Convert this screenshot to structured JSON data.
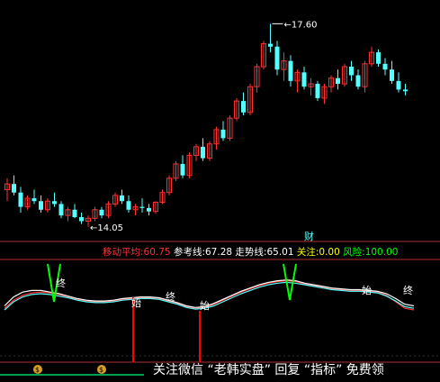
{
  "chart_data": [
    {
      "type": "candlestick",
      "panel": "price",
      "annotations": {
        "high_label": "17.60",
        "low_label": "14.05"
      },
      "colors": {
        "up": "#ff3232",
        "down": "#54ffff"
      },
      "candles": [
        [
          14.7,
          14.9,
          14.5,
          14.8
        ],
        [
          14.8,
          14.95,
          14.6,
          14.65
        ],
        [
          14.65,
          14.75,
          14.3,
          14.4
        ],
        [
          14.4,
          14.6,
          14.35,
          14.55
        ],
        [
          14.55,
          14.7,
          14.45,
          14.5
        ],
        [
          14.5,
          14.6,
          14.3,
          14.35
        ],
        [
          14.35,
          14.55,
          14.3,
          14.5
        ],
        [
          14.5,
          14.65,
          14.4,
          14.45
        ],
        [
          14.45,
          14.5,
          14.2,
          14.25
        ],
        [
          14.25,
          14.4,
          14.15,
          14.35
        ],
        [
          14.35,
          14.45,
          14.2,
          14.22
        ],
        [
          14.22,
          14.3,
          14.1,
          14.15
        ],
        [
          14.15,
          14.25,
          14.05,
          14.2
        ],
        [
          14.2,
          14.4,
          14.15,
          14.35
        ],
        [
          14.35,
          14.4,
          14.2,
          14.25
        ],
        [
          14.25,
          14.5,
          14.2,
          14.45
        ],
        [
          14.45,
          14.65,
          14.4,
          14.6
        ],
        [
          14.6,
          14.7,
          14.45,
          14.5
        ],
        [
          14.5,
          14.6,
          14.3,
          14.35
        ],
        [
          14.35,
          14.45,
          14.25,
          14.4
        ],
        [
          14.4,
          14.55,
          14.3,
          14.38
        ],
        [
          14.38,
          14.45,
          14.25,
          14.32
        ],
        [
          14.32,
          14.5,
          14.28,
          14.48
        ],
        [
          14.48,
          14.7,
          14.45,
          14.65
        ],
        [
          14.65,
          14.95,
          14.6,
          14.9
        ],
        [
          14.9,
          15.2,
          14.85,
          15.15
        ],
        [
          15.15,
          15.3,
          14.9,
          14.95
        ],
        [
          14.95,
          15.35,
          14.9,
          15.3
        ],
        [
          15.3,
          15.5,
          15.2,
          15.45
        ],
        [
          15.45,
          15.6,
          15.2,
          15.25
        ],
        [
          15.25,
          15.55,
          15.2,
          15.5
        ],
        [
          15.5,
          15.8,
          15.4,
          15.75
        ],
        [
          15.75,
          15.9,
          15.55,
          15.6
        ],
        [
          15.6,
          16.0,
          15.55,
          15.95
        ],
        [
          15.95,
          16.3,
          15.9,
          16.25
        ],
        [
          16.25,
          16.4,
          16.0,
          16.05
        ],
        [
          16.05,
          16.55,
          16.0,
          16.5
        ],
        [
          16.5,
          16.9,
          16.4,
          16.85
        ],
        [
          16.85,
          17.3,
          16.8,
          17.25
        ],
        [
          17.25,
          17.6,
          17.1,
          17.2
        ],
        [
          17.2,
          17.3,
          16.7,
          16.8
        ],
        [
          16.8,
          17.1,
          16.6,
          16.95
        ],
        [
          16.95,
          17.05,
          16.5,
          16.6
        ],
        [
          16.6,
          16.8,
          16.4,
          16.75
        ],
        [
          16.75,
          16.85,
          16.45,
          16.5
        ],
        [
          16.5,
          16.65,
          16.35,
          16.55
        ],
        [
          16.55,
          16.6,
          16.25,
          16.3
        ],
        [
          16.3,
          16.55,
          16.2,
          16.5
        ],
        [
          16.5,
          16.7,
          16.4,
          16.65
        ],
        [
          16.65,
          16.8,
          16.45,
          16.55
        ],
        [
          16.55,
          16.9,
          16.5,
          16.85
        ],
        [
          16.85,
          16.95,
          16.6,
          16.7
        ],
        [
          16.7,
          16.8,
          16.45,
          16.5
        ],
        [
          16.5,
          16.95,
          16.4,
          16.9
        ],
        [
          16.9,
          17.2,
          16.85,
          17.1
        ],
        [
          17.1,
          17.15,
          16.85,
          16.9
        ],
        [
          16.9,
          17.0,
          16.7,
          16.8
        ],
        [
          16.8,
          16.95,
          16.55,
          16.6
        ],
        [
          16.6,
          16.75,
          16.4,
          16.45
        ],
        [
          16.45,
          16.55,
          16.35,
          16.42
        ]
      ]
    },
    {
      "type": "line",
      "panel": "indicator",
      "legend": [
        {
          "label": "移动平均:",
          "value": "60.75",
          "color": "#ff3232"
        },
        {
          "label": "参考线:",
          "value": "67.28",
          "color": "#ffffff"
        },
        {
          "label": "走势线:",
          "value": "65.01",
          "color": "#ffffff"
        },
        {
          "label": "关注:",
          "value": "0.00",
          "color": "#ffff00"
        },
        {
          "label": "风险:",
          "value": "100.00",
          "color": "#00ff00"
        }
      ],
      "marker_label": "财",
      "ylim": [
        0,
        100
      ],
      "series": [
        {
          "name": "移动平均",
          "color": "#ff3232",
          "values": [
            42,
            52,
            58,
            61,
            62,
            61,
            59,
            56,
            53,
            51,
            50,
            50,
            51,
            53,
            54,
            55,
            55,
            54,
            51,
            48,
            44,
            42,
            43,
            47,
            52,
            57,
            62,
            66,
            70,
            73,
            75,
            76,
            75,
            72,
            70,
            68,
            66,
            65,
            64,
            64,
            63,
            62,
            58,
            50,
            42,
            40
          ]
        },
        {
          "name": "参考线",
          "color": "#ffffff",
          "values": [
            45,
            56,
            62,
            64,
            64,
            62,
            60,
            57,
            54,
            52,
            51,
            51,
            52,
            54,
            55,
            56,
            56,
            55,
            52,
            49,
            45,
            43,
            44,
            48,
            53,
            58,
            63,
            67,
            71,
            74,
            76,
            77,
            76,
            73,
            71,
            69,
            67,
            66,
            65,
            65,
            64,
            63,
            60,
            54,
            47,
            45
          ]
        },
        {
          "name": "走势线",
          "color": "#54ffff",
          "values": [
            40,
            50,
            56,
            59,
            60,
            59,
            57,
            55,
            52,
            50,
            49,
            49,
            50,
            52,
            53,
            54,
            54,
            53,
            50,
            47,
            43,
            41,
            42,
            45,
            50,
            55,
            60,
            64,
            68,
            71,
            73,
            74,
            73,
            71,
            69,
            67,
            65,
            64,
            63,
            63,
            62,
            61,
            57,
            51,
            44,
            42
          ]
        }
      ],
      "text_labels": [
        "终",
        "始",
        "终",
        "始",
        "始",
        "终"
      ],
      "oversold_marks": 2,
      "overbought_marks": 2
    }
  ],
  "watermark": "关注微信 “老韩实盘” 回复 “指标” 免费领"
}
